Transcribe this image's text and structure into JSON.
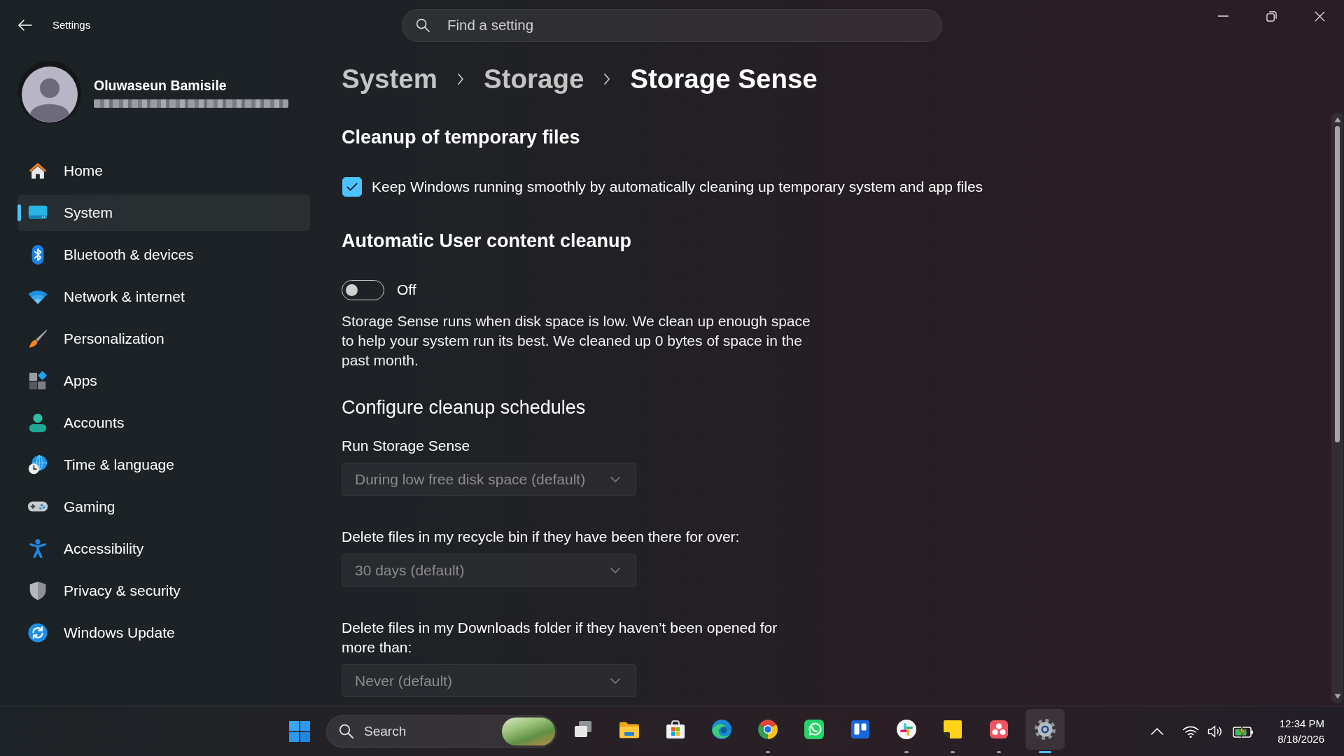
{
  "window": {
    "title": "Settings"
  },
  "search": {
    "placeholder": "Find a setting"
  },
  "account": {
    "name": "Oluwaseun Bamisile"
  },
  "nav": [
    {
      "label": "Home",
      "selected": false
    },
    {
      "label": "System",
      "selected": true
    },
    {
      "label": "Bluetooth & devices",
      "selected": false
    },
    {
      "label": "Network & internet",
      "selected": false
    },
    {
      "label": "Personalization",
      "selected": false
    },
    {
      "label": "Apps",
      "selected": false
    },
    {
      "label": "Accounts",
      "selected": false
    },
    {
      "label": "Time & language",
      "selected": false
    },
    {
      "label": "Gaming",
      "selected": false
    },
    {
      "label": "Accessibility",
      "selected": false
    },
    {
      "label": "Privacy & security",
      "selected": false
    },
    {
      "label": "Windows Update",
      "selected": false
    }
  ],
  "breadcrumb": [
    {
      "label": "System",
      "current": false
    },
    {
      "label": "Storage",
      "current": false
    },
    {
      "label": "Storage Sense",
      "current": true
    }
  ],
  "temporary_files": {
    "heading": "Cleanup of temporary files",
    "checkbox": {
      "label": "Keep Windows running smoothly by automatically cleaning up temporary system and app files",
      "checked": true
    }
  },
  "user_content": {
    "heading": "Automatic User content cleanup",
    "toggle": {
      "label": "Off",
      "on": false
    },
    "description": "Storage Sense runs when disk space is low. We clean up enough space to help your system run its best. We cleaned up 0 bytes of space in the past month."
  },
  "schedules": {
    "heading": "Configure cleanup schedules",
    "settings": [
      {
        "label": "Run Storage Sense",
        "value": "During low free disk space (default)",
        "disabled": true
      },
      {
        "label": "Delete files in my recycle bin if they have been there for over:",
        "value": "30 days (default)",
        "disabled": true
      },
      {
        "label": "Delete files in my Downloads folder if they haven’t been opened for more than:",
        "value": "Never (default)",
        "disabled": true
      }
    ]
  },
  "taskbar": {
    "search": {
      "placeholder": "Search"
    },
    "apps": [
      {
        "running": false,
        "selected": false
      },
      {
        "running": false,
        "selected": false
      },
      {
        "running": false,
        "selected": false
      },
      {
        "running": false,
        "selected": false
      },
      {
        "running": true,
        "selected": false
      },
      {
        "running": false,
        "selected": false
      },
      {
        "running": false,
        "selected": false
      },
      {
        "running": true,
        "selected": false
      },
      {
        "running": true,
        "selected": false
      },
      {
        "running": true,
        "selected": false
      },
      {
        "running": true,
        "selected": true
      }
    ],
    "clock": {
      "time": "12:34 PM",
      "date": "8/18/2026"
    }
  }
}
